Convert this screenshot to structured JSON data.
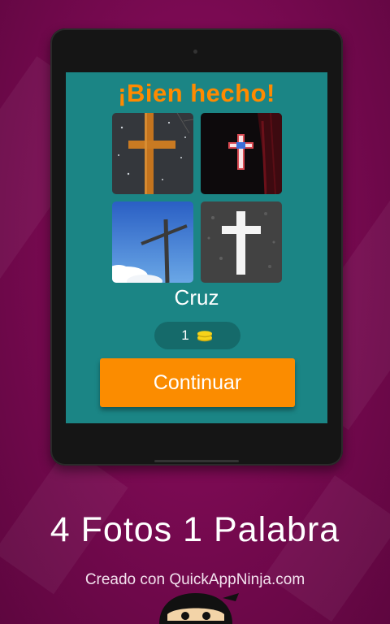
{
  "game": {
    "success_title": "¡Bien hecho!",
    "answer": "Cruz",
    "reward": {
      "count": "1",
      "icon": "coins-icon"
    },
    "continue_label": "Continuar"
  },
  "photos": [
    {
      "name": "photo-wooden-cross",
      "icon": "wooden-cross-image"
    },
    {
      "name": "photo-lit-cross",
      "icon": "neon-cross-image"
    },
    {
      "name": "photo-sky-cross",
      "icon": "sky-cross-image"
    },
    {
      "name": "photo-white-cross",
      "icon": "white-cross-image"
    }
  ],
  "footer": {
    "brand": "4 Fotos 1 Palabra",
    "credit": "Creado con QuickAppNinja.com"
  },
  "colors": {
    "background": "#7a0a52",
    "screen": "#1b8585",
    "accent": "#fb8c00",
    "title": "#ff8a00",
    "pill": "#156a6a",
    "coin": "#f6d31a"
  }
}
